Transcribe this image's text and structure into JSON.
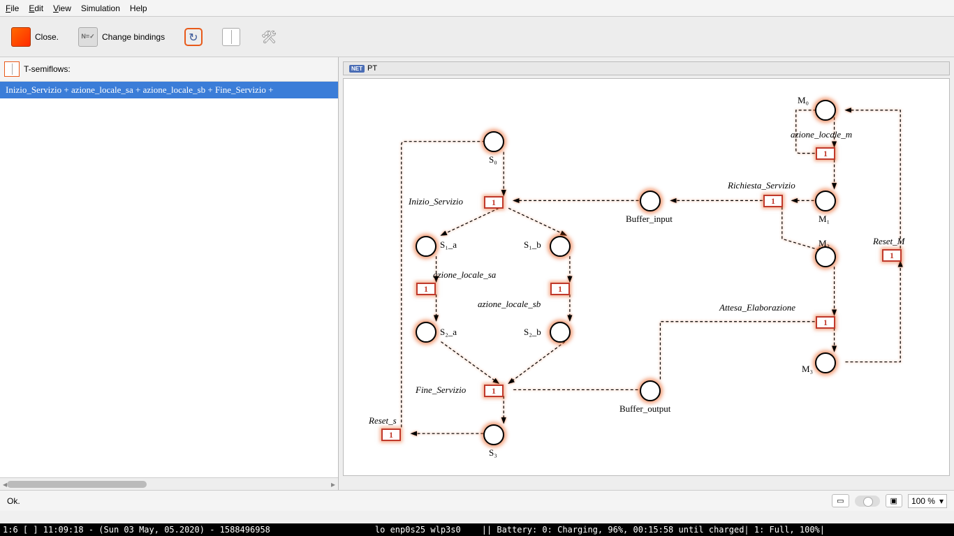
{
  "menu": {
    "file": "File",
    "edit": "Edit",
    "view": "View",
    "simulation": "Simulation",
    "help": "Help"
  },
  "toolbar": {
    "close": "Close.",
    "bindings": "Change bindings"
  },
  "left": {
    "title": "T-semiflows:",
    "item": "Inizio_Servizio + azione_locale_sa + azione_locale_sb + Fine_Servizio +"
  },
  "net": {
    "title": "PT",
    "badge": "NET"
  },
  "places": {
    "S0": "S₀",
    "S1a": "S₁_a",
    "S1b": "S₁_b",
    "S2a": "S₂_a",
    "S2b": "S₂_b",
    "S3": "S₃",
    "Bin": "Buffer_input",
    "Bout": "Buffer_output",
    "M0": "M₀",
    "M1": "M₁",
    "M2": "M₂",
    "M3": "M₃"
  },
  "transitions": {
    "inizio": "Inizio_Servizio",
    "az_sa": "azione_locale_sa",
    "az_sb": "azione_locale_sb",
    "fine": "Fine_Servizio",
    "reset_s": "Reset_s",
    "az_m": "azione_locale_m",
    "rich": "Richiesta_Servizio",
    "attesa": "Attesa_Elaborazione",
    "reset_m": "Reset_M",
    "val": "1"
  },
  "status": {
    "msg": "Ok.",
    "zoom": "100 %"
  },
  "taskbar": {
    "left": "1:6 [ ]    11:09:18 - (Sun 03 May, 05.2020) - 1588496958",
    "mid": "lo enp0s25 wlp3s0",
    "right": "||   Battery: 0: Charging, 96%, 00:15:58 until charged| 1: Full, 100%|"
  }
}
